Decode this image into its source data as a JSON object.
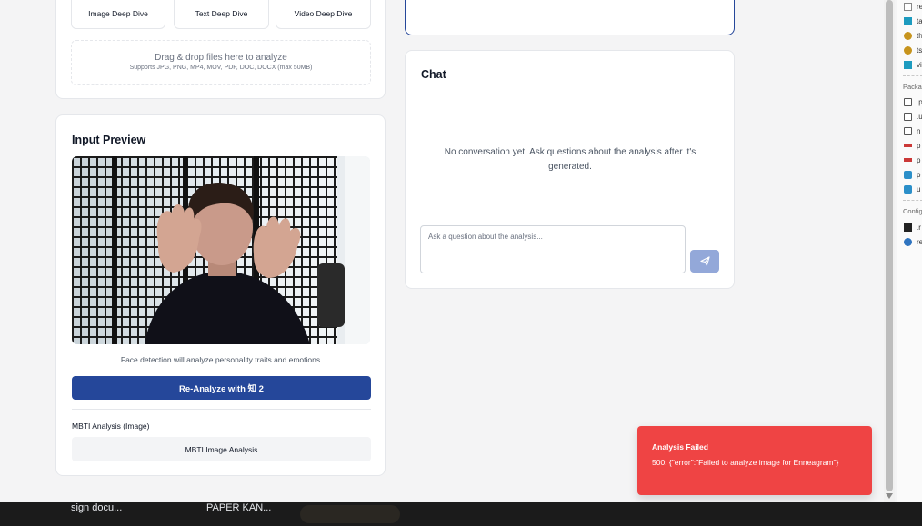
{
  "upload": {
    "buttons": {
      "image": "Image Deep Dive",
      "text": "Text Deep Dive",
      "video": "Video Deep Dive"
    },
    "dropzone": {
      "title": "Drag & drop files here to analyze",
      "subtitle": "Supports JPG, PNG, MP4, MOV, PDF, DOC, DOCX (max 50MB)"
    }
  },
  "preview": {
    "title": "Input Preview",
    "caption": "Face detection will analyze personality traits and emotions",
    "reanalyze_label": "Re-Analyze with 知 2",
    "mbti_label": "MBTI Analysis (Image)",
    "mbti_button": "MBTI Image Analysis"
  },
  "chat": {
    "title": "Chat",
    "empty_message": "No conversation yet. Ask questions about the analysis after it's generated.",
    "input_placeholder": "Ask a question about the analysis...",
    "send_icon": "send-icon"
  },
  "toast": {
    "title": "Analysis Failed",
    "message": "500: {\"error\":\"Failed to analyze image for Enneagram\"}",
    "color": "#ef4444"
  },
  "taskbar": {
    "items": [
      "sign docu...",
      "PAPER KAN..."
    ]
  },
  "side_panel": {
    "files_top": [
      "re",
      "ta",
      "th",
      "ts",
      "vi"
    ],
    "packages_heading": "Packa",
    "packages": [
      ".p",
      ".u",
      "n",
      "p",
      "p",
      "p",
      "u"
    ],
    "config_heading": "Config",
    "config": [
      ".r",
      "re"
    ]
  },
  "colors": {
    "primary": "#25479a",
    "send_disabled": "#93a8d9",
    "error": "#ef4444"
  }
}
